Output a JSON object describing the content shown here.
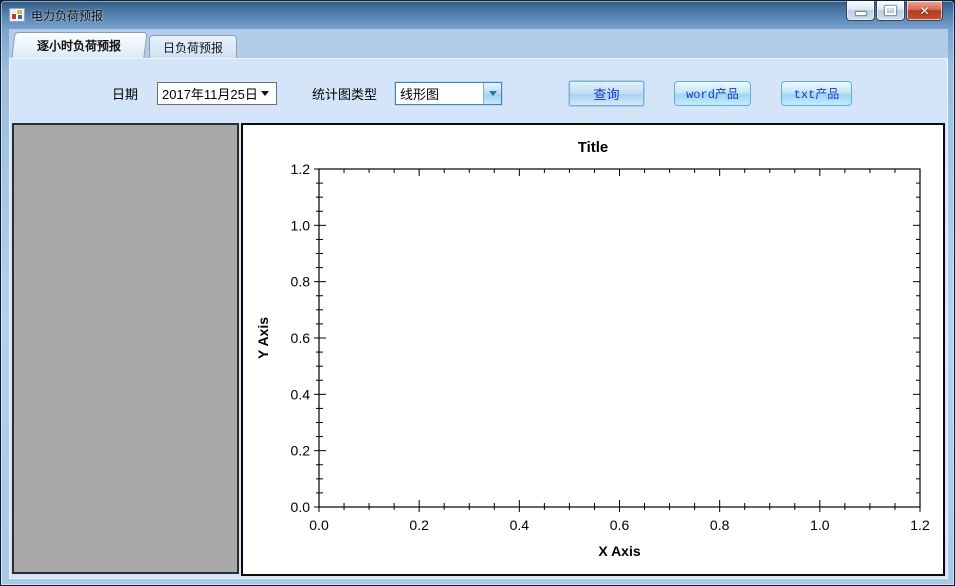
{
  "window": {
    "title": "电力负荷预报",
    "controls": {
      "minimize": "minimize-button",
      "maximize": "maximize-button",
      "close": "close-button"
    }
  },
  "tabs": [
    {
      "label": "逐小时负荷预报",
      "active": true
    },
    {
      "label": "日负荷预报",
      "active": false
    }
  ],
  "toolbar": {
    "date_label": "日期",
    "date_value": "2017年11月25日",
    "chart_type_label": "统计图类型",
    "chart_type_value": "线形图",
    "query_button": "查询",
    "word_button": "word产品",
    "txt_button": "txt产品"
  },
  "colors": {
    "accent_combo_border": "#3f7fbf",
    "button_text_blue": "#1b34c9",
    "close_button_red": "#b03c24",
    "left_panel_gray": "#a9a9a9",
    "tabpage_blue": "#d4e5f9"
  },
  "chart_data": {
    "type": "line",
    "title": "Title",
    "xlabel": "X Axis",
    "ylabel": "Y Axis",
    "xlim": [
      0,
      1.2
    ],
    "ylim": [
      0,
      1.2
    ],
    "x_major_step": 0.2,
    "x_minor_step": 0.05,
    "y_major_step": 0.2,
    "y_minor_step": 0.05,
    "x_ticks": [
      "0.0",
      "0.2",
      "0.4",
      "0.6",
      "0.8",
      "1.0",
      "1.2"
    ],
    "y_ticks": [
      "0.0",
      "0.2",
      "0.4",
      "0.6",
      "0.8",
      "1.0",
      "1.2"
    ],
    "series": [],
    "grid": false,
    "legend": false,
    "plot_background": "#ffffff"
  }
}
